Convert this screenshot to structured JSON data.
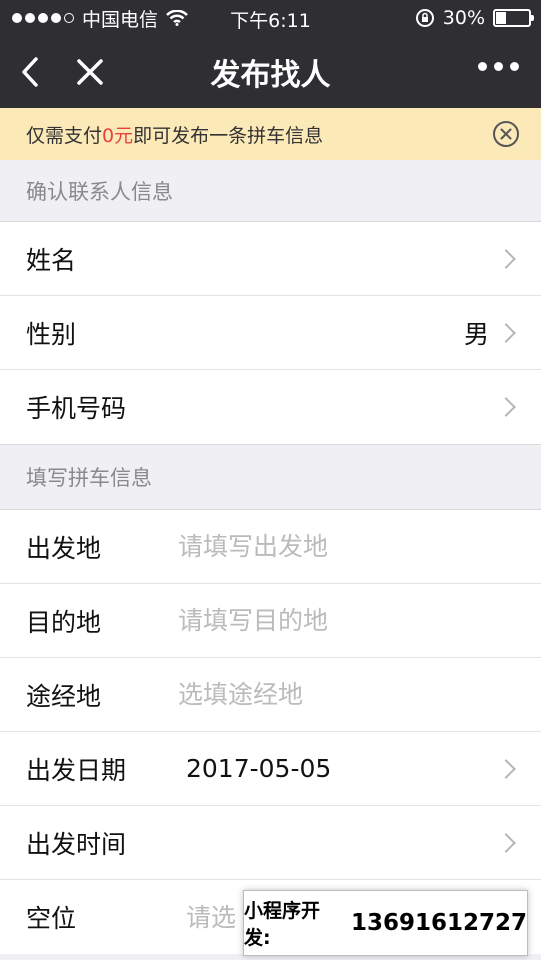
{
  "status_bar": {
    "carrier": "中国电信",
    "time": "下午6:11",
    "battery": "30%",
    "battery_level": 0.3
  },
  "nav": {
    "title": "发布找人"
  },
  "notice": {
    "prefix": "仅需支付",
    "amount": "0元",
    "suffix": "即可发布一条拼车信息"
  },
  "contact_section": {
    "header": "确认联系人信息",
    "rows": [
      {
        "label": "姓名",
        "value": ""
      },
      {
        "label": "性别",
        "value": "男"
      },
      {
        "label": "手机号码",
        "value": ""
      }
    ]
  },
  "trip_section": {
    "header": "填写拼车信息",
    "origin": {
      "label": "出发地",
      "placeholder": "请填写出发地"
    },
    "destination": {
      "label": "目的地",
      "placeholder": "请填写目的地"
    },
    "via": {
      "label": "途经地",
      "placeholder": "选填途经地"
    },
    "date": {
      "label": "出发日期",
      "value": "2017-05-05"
    },
    "time": {
      "label": "出发时间",
      "value": ""
    },
    "seats": {
      "label": "空位",
      "placeholder": "请选"
    }
  },
  "watermark": {
    "label": "小程序开发:",
    "phone": "13691612727"
  },
  "colors": {
    "nav_bg": "#2f2f33",
    "notice_bg": "#fce9b8",
    "highlight": "#e64340"
  }
}
